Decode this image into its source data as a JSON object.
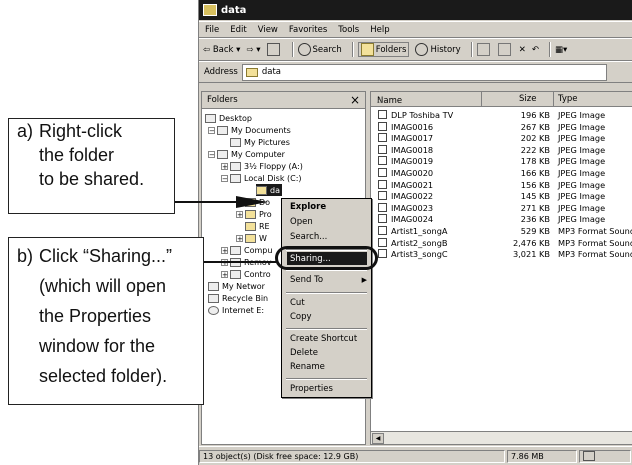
{
  "window": {
    "title": "data",
    "menu": [
      "File",
      "Edit",
      "View",
      "Favorites",
      "Tools",
      "Help"
    ],
    "toolbar": {
      "back": "Back",
      "search": "Search",
      "folders": "Folders",
      "history": "History"
    },
    "address": {
      "label": "Address",
      "value": "data"
    }
  },
  "folders_pane": {
    "title": "Folders",
    "close": "×",
    "tree": [
      "Desktop",
      "My Documents",
      "My Pictures",
      "My Computer",
      "3½ Floppy (A:)",
      "Local Disk (C:)",
      "da",
      "Do",
      "Pro",
      "RE",
      "W",
      "Compu",
      "Remov",
      "Contro",
      "My Networ",
      "Recycle Bin",
      "Internet E:"
    ]
  },
  "files_pane": {
    "columns": {
      "name": "Name",
      "size": "Size",
      "type": "Type"
    },
    "rows": [
      {
        "name": "DLP Toshiba TV",
        "size": "196 KB",
        "type": "JPEG Image"
      },
      {
        "name": "IMAG0016",
        "size": "267 KB",
        "type": "JPEG Image"
      },
      {
        "name": "IMAG0017",
        "size": "202 KB",
        "type": "JPEG Image"
      },
      {
        "name": "IMAG0018",
        "size": "222 KB",
        "type": "JPEG Image"
      },
      {
        "name": "IMAG0019",
        "size": "178 KB",
        "type": "JPEG Image"
      },
      {
        "name": "IMAG0020",
        "size": "166 KB",
        "type": "JPEG Image"
      },
      {
        "name": "IMAG0021",
        "size": "156 KB",
        "type": "JPEG Image"
      },
      {
        "name": "IMAG0022",
        "size": "145 KB",
        "type": "JPEG Image"
      },
      {
        "name": "IMAG0023",
        "size": "271 KB",
        "type": "JPEG Image"
      },
      {
        "name": "IMAG0024",
        "size": "236 KB",
        "type": "JPEG Image"
      },
      {
        "name": "Artist1_songA",
        "size": "529 KB",
        "type": "MP3 Format Sound"
      },
      {
        "name": "Artist2_songB",
        "size": "2,476 KB",
        "type": "MP3 Format Sound"
      },
      {
        "name": "Artist3_songC",
        "size": "3,021 KB",
        "type": "MP3 Format Sound"
      }
    ]
  },
  "context_menu": {
    "items": [
      "Explore",
      "Open",
      "Search...",
      "Sharing...",
      "Send To",
      "Cut",
      "Copy",
      "Create Shortcut",
      "Delete",
      "Rename",
      "Properties"
    ]
  },
  "status": {
    "objects": "13 object(s) (Disk free space: 12.9 GB)",
    "size": "7.86 MB"
  },
  "callouts": {
    "a": {
      "label": "a)",
      "lines": [
        "Right-click",
        "the folder",
        "to be shared."
      ]
    },
    "b": {
      "label": "b)",
      "lines": [
        "Click “Sharing...”",
        "(which will open",
        "the Properties",
        "window for the",
        "selected folder)."
      ]
    }
  }
}
